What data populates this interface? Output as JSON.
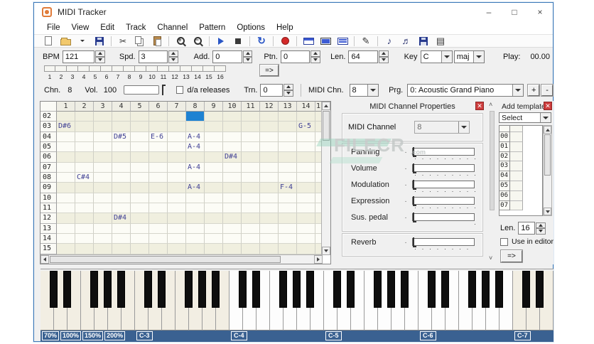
{
  "window": {
    "title": "MIDI Tracker",
    "controls": [
      {
        "name": "minimize-button",
        "glyph": "–"
      },
      {
        "name": "maximize-button",
        "glyph": "□"
      },
      {
        "name": "close-button",
        "glyph": "×"
      }
    ]
  },
  "menu": {
    "items": [
      "File",
      "View",
      "Edit",
      "Track",
      "Channel",
      "Pattern",
      "Options",
      "Help"
    ]
  },
  "toolbar": {
    "items": [
      {
        "name": "new-icon"
      },
      {
        "name": "open-icon"
      },
      {
        "name": "open-caret-icon"
      },
      {
        "name": "save-icon"
      },
      {
        "sep": true
      },
      {
        "name": "cut-icon",
        "glyph": "✂"
      },
      {
        "name": "copy-icon"
      },
      {
        "name": "paste-icon"
      },
      {
        "sep": true
      },
      {
        "name": "zoom-in-icon",
        "glyph": "+"
      },
      {
        "name": "zoom-out-icon",
        "glyph": "−"
      },
      {
        "sep": true
      },
      {
        "name": "play-icon"
      },
      {
        "name": "stop-icon"
      },
      {
        "sep": true
      },
      {
        "name": "loop-icon",
        "glyph": "↻"
      },
      {
        "sep": true
      },
      {
        "name": "record-icon"
      },
      {
        "sep": true
      },
      {
        "name": "panel-top-icon"
      },
      {
        "name": "panel-screen-icon"
      },
      {
        "name": "panel-rows-icon"
      },
      {
        "sep": true
      },
      {
        "name": "pencil-icon",
        "glyph": "✎"
      },
      {
        "sep": true
      },
      {
        "name": "note-export-icon",
        "glyph": "♪"
      },
      {
        "name": "note-import-icon",
        "glyph": "♬"
      },
      {
        "name": "disk-small-icon"
      },
      {
        "name": "grid-list-icon",
        "glyph": "▤"
      }
    ]
  },
  "params": {
    "bpm": {
      "label": "BPM",
      "value": "121"
    },
    "spd": {
      "label": "Spd.",
      "value": "3"
    },
    "add": {
      "label": "Add.",
      "value": "0"
    },
    "ptn": {
      "label": "Ptn.",
      "value": "0"
    },
    "len": {
      "label": "Len.",
      "value": "64"
    },
    "key": {
      "label": "Key",
      "value": "C",
      "mode": "maj"
    },
    "play": {
      "label": "Play:",
      "value": "00.00"
    }
  },
  "pattern_strip": {
    "numbers": [
      "1",
      "2",
      "3",
      "4",
      "5",
      "6",
      "7",
      "8",
      "9",
      "10",
      "11",
      "12",
      "13",
      "14",
      "15",
      "16"
    ],
    "go_label": "=>"
  },
  "channel_bar": {
    "chn_label": "Chn.",
    "chn_value": "8",
    "vol_label": "Vol.",
    "vol_value": "100",
    "da_label": "d/a releases",
    "trn_label": "Trn.",
    "trn_value": "0",
    "midichn_label": "MIDI Chn.",
    "midichn_value": "8",
    "prg_label": "Prg.",
    "prg_value": "0: Acoustic Grand Piano",
    "plus_label": "+",
    "minus_label": "-"
  },
  "grid": {
    "col_headers": [
      "1",
      "2",
      "3",
      "4",
      "5",
      "6",
      "7",
      "8",
      "9",
      "10",
      "11",
      "12",
      "13",
      "14",
      "1"
    ],
    "selected_cell": {
      "row": "02",
      "col": "8"
    },
    "rows": [
      {
        "label": "02",
        "highlight": true,
        "notes": {}
      },
      {
        "label": "03",
        "highlight": true,
        "notes": {
          "1": "D#6",
          "14": "G-5"
        }
      },
      {
        "label": "04",
        "highlight": false,
        "notes": {
          "4": "D#5",
          "6": "E-6",
          "8": "A-4"
        }
      },
      {
        "label": "05",
        "highlight": false,
        "notes": {
          "8": "A-4"
        }
      },
      {
        "label": "06",
        "highlight": true,
        "notes": {
          "10": "D#4"
        }
      },
      {
        "label": "07",
        "highlight": false,
        "notes": {
          "8": "A-4"
        }
      },
      {
        "label": "08",
        "highlight": false,
        "notes": {
          "2": "C#4"
        }
      },
      {
        "label": "09",
        "highlight": true,
        "notes": {
          "8": "A-4",
          "13": "F-4"
        }
      },
      {
        "label": "10",
        "highlight": false,
        "notes": {}
      },
      {
        "label": "11",
        "highlight": false,
        "notes": {}
      },
      {
        "label": "12",
        "highlight": true,
        "notes": {
          "4": "D#4"
        }
      },
      {
        "label": "13",
        "highlight": false,
        "notes": {}
      },
      {
        "label": "14",
        "highlight": false,
        "notes": {}
      },
      {
        "label": "15",
        "highlight": true,
        "notes": {}
      }
    ]
  },
  "properties": {
    "title": "MIDI Channel Properties",
    "channel_label": "MIDI Channel",
    "channel_value": "8",
    "tick": "·",
    "sliders": [
      {
        "label": "Panning",
        "dots": 9
      },
      {
        "label": "Volume",
        "dots": 9
      },
      {
        "label": "Modulation",
        "dots": 9
      },
      {
        "label": "Expression",
        "dots": 9
      },
      {
        "label": "Sus. pedal",
        "dots": 1
      }
    ],
    "reverb": {
      "label": "Reverb",
      "dots": 8
    }
  },
  "template_panel": {
    "title": "Add template",
    "select_label": "Select",
    "rows": [
      "00",
      "01",
      "02",
      "03",
      "04",
      "05",
      "06",
      "07"
    ],
    "len_label": "Len.",
    "len_value": "16",
    "use_label": "Use in editor",
    "go_label": "=>"
  },
  "keyboard": {
    "white_keys": 38,
    "bright_range": [
      14,
      34
    ],
    "zoom_buttons": [
      "70%",
      "100%",
      "150%",
      "200%"
    ],
    "octave_labels": [
      {
        "label": "C-3",
        "key": 7
      },
      {
        "label": "C-4",
        "key": 14
      },
      {
        "label": "C-5",
        "key": 21
      },
      {
        "label": "C-6",
        "key": 28
      },
      {
        "label": "C-7",
        "key": 35
      }
    ]
  },
  "watermark": {
    "text": "FILECR",
    "suffix": ".com"
  },
  "colors": {
    "accent_blue": "#1e82d2",
    "window_border": "#3d79b8",
    "keyboard_bar": "#3a6191",
    "close_red": "#cd3d3d",
    "note_text": "#3f3f94",
    "highlight_row": "#f0efdf",
    "watermark_teal": "#8fd0b8"
  }
}
